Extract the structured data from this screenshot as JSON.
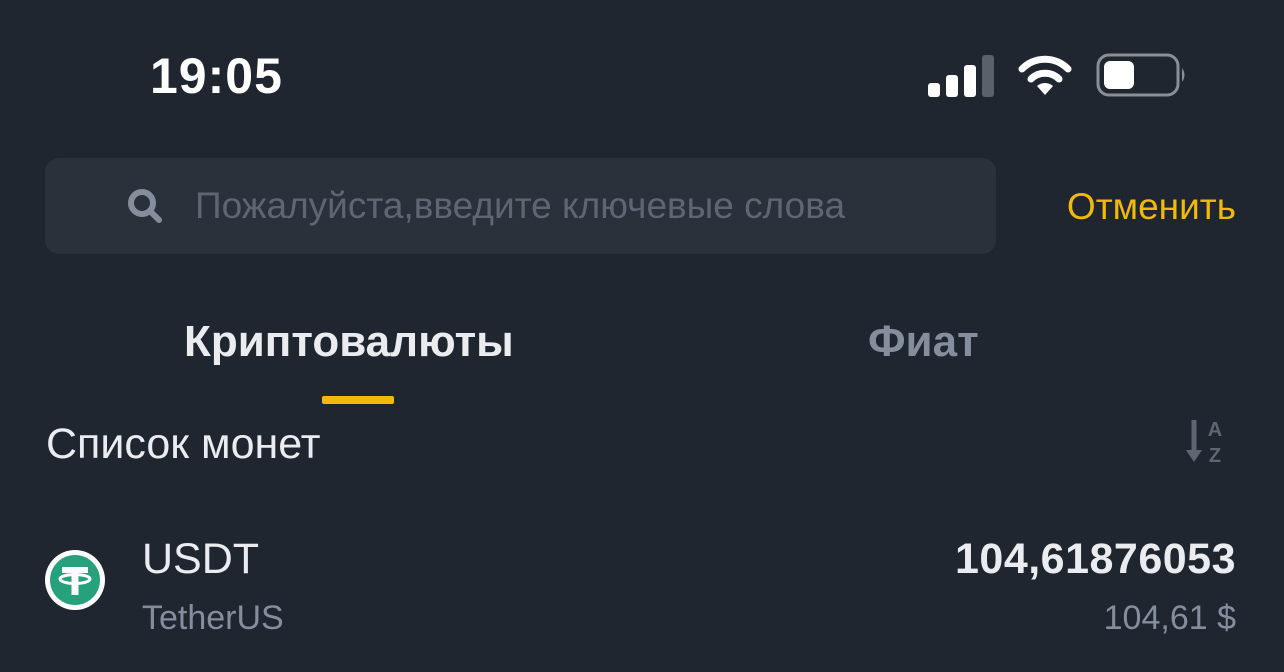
{
  "status_bar": {
    "time": "19:05",
    "signal_icon": "cellular-signal-icon",
    "wifi_icon": "wifi-icon",
    "battery_icon": "battery-icon"
  },
  "search": {
    "placeholder": "Пожалуйста,введите ключевые слова",
    "value": "",
    "icon": "search-icon",
    "cancel_label": "Отменить"
  },
  "tabs": [
    {
      "label": "Криптовалюты",
      "active": true
    },
    {
      "label": "Фиат",
      "active": false
    }
  ],
  "coin_list": {
    "title": "Список монет",
    "sort_icon": "sort-az-icon",
    "items": [
      {
        "symbol": "USDT",
        "name": "TetherUS",
        "amount": "104,61876053",
        "fiat_value": "104,61 $",
        "icon": "tether-logo-icon"
      }
    ]
  },
  "colors": {
    "background": "#1f2630",
    "accent": "#f0b90b",
    "primary_text": "#eaecef",
    "secondary_text": "#848e9c",
    "search_bg": "#2b313a",
    "tether_green": "#26a17b"
  }
}
